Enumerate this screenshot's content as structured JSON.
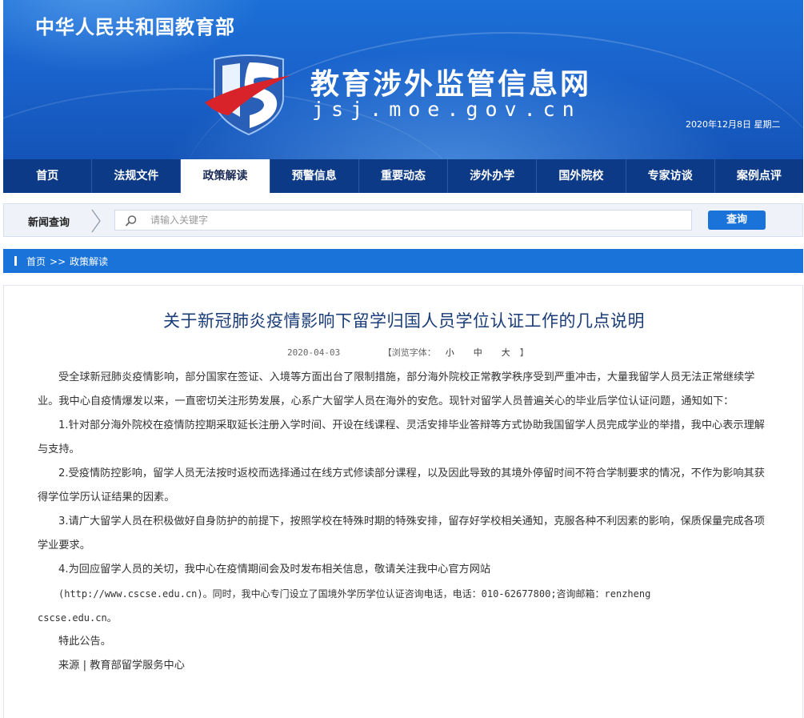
{
  "header": {
    "ministry": "中华人民共和国教育部",
    "site_name": "教育涉外监管信息网",
    "site_domain": "jsj.moe.gov.cn",
    "date": "2020年12月8日 星期二"
  },
  "nav": {
    "items": [
      {
        "label": "首页"
      },
      {
        "label": "法规文件"
      },
      {
        "label": "政策解读"
      },
      {
        "label": "预警信息"
      },
      {
        "label": "重要动态"
      },
      {
        "label": "涉外办学"
      },
      {
        "label": "国外院校"
      },
      {
        "label": "专家访谈"
      },
      {
        "label": "案例点评"
      }
    ],
    "active_index": 2
  },
  "search": {
    "label": "新闻查询",
    "placeholder": "请输入关键字",
    "value": "",
    "button": "查询"
  },
  "breadcrumb": {
    "home": "首页",
    "separator": ">>",
    "current": "政策解读"
  },
  "article": {
    "title": "关于新冠肺炎疫情影响下留学归国人员学位认证工作的几点说明",
    "date": "2020-04-03",
    "font_size_label": "【浏览字体：",
    "font_size_small": "小",
    "font_size_medium": "中",
    "font_size_large": "大",
    "font_size_close": "】",
    "paragraphs": [
      "受全球新冠肺炎疫情影响，部分国家在签证、入境等方面出台了限制措施，部分海外院校正常教学秩序受到严重冲击，大量我留学人员无法正常继续学业。我中心自疫情爆发以来，一直密切关注形势发展，心系广大留学人员在海外的安危。现针对留学人员普遍关心的毕业后学位认证问题，通知如下：",
      "1.针对部分海外院校在疫情防控期采取延长注册入学时间、开设在线课程、灵活安排毕业答辩等方式协助我国留学人员完成学业的举措，我中心表示理解与支持。",
      "2.受疫情防控影响，留学人员无法按时返校而选择通过在线方式修读部分课程，以及因此导致的其境外停留时间不符合学制要求的情况，不作为影响其获得学位学历认证结果的因素。",
      "3.请广大留学人员在积极做好自身防护的前提下，按照学校在特殊时期的特殊安排，留存好学校相关通知，克服各种不利因素的影响，保质保量完成各项学业要求。",
      "4.为回应留学人员的关切，我中心在疫情期间会及时发布相关信息，敬请关注我中心官方网站"
    ],
    "contact_line": "(http://www.cscse.edu.cn)。同时，我中心专门设立了国境外学历学位认证咨询电话，电话：010-62677800;咨询邮箱：renzheng",
    "contact_email_tail": "cscse.edu.cn。",
    "closing": "特此公告。",
    "source": "来源 | 教育部留学服务中心"
  },
  "colors": {
    "banner_blue": "#1a63cc",
    "nav_dark": "#0d3a86",
    "accent_blue": "#1a73d9",
    "title_blue": "#1a3c78",
    "logo_red": "#d8232a"
  }
}
